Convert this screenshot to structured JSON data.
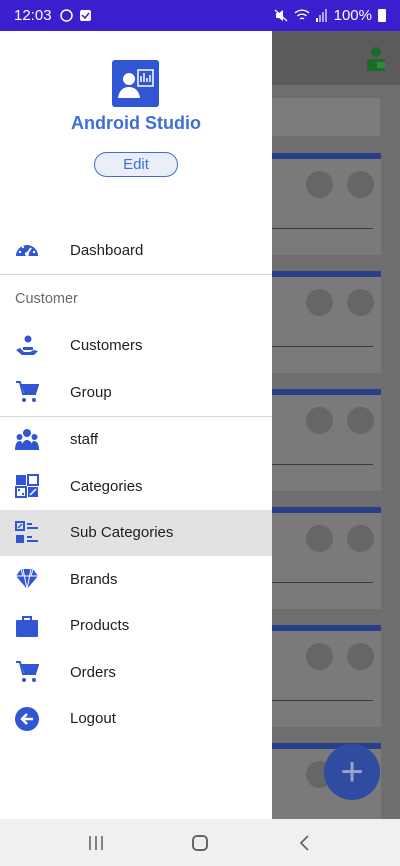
{
  "status_bar": {
    "time": "12:03",
    "battery": "100%"
  },
  "drawer": {
    "app_name": "Android Studio",
    "edit_label": "Edit",
    "items_top": [
      {
        "label": "Dashboard",
        "icon": "speedometer-icon"
      }
    ],
    "section_label": "Customer",
    "customer_items": [
      {
        "label": "Customers",
        "icon": "customer-hand-icon"
      },
      {
        "label": "Group",
        "icon": "cart-icon"
      }
    ],
    "catalog_items": [
      {
        "label": "staff",
        "icon": "people-group-icon"
      },
      {
        "label": "Categories",
        "icon": "categories-grid-icon"
      },
      {
        "label": "Sub Categories",
        "icon": "sub-categories-icon",
        "active": true
      },
      {
        "label": "Brands",
        "icon": "diamond-icon"
      },
      {
        "label": "Products",
        "icon": "briefcase-icon"
      },
      {
        "label": "Orders",
        "icon": "cart-icon"
      },
      {
        "label": "Logout",
        "icon": "logout-arrow-icon"
      }
    ]
  },
  "colors": {
    "status_bar": "#3a1fcf",
    "accent": "#3f6fd2",
    "icon_blue": "#3156d3",
    "active_bg": "#e2e2e2"
  }
}
